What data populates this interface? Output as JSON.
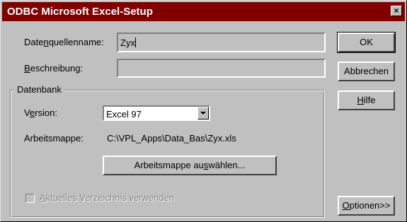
{
  "window": {
    "title": "ODBC Microsoft Excel-Setup",
    "close_label": "×"
  },
  "form": {
    "datasource_name": {
      "label_pre": "Date",
      "label_accel": "n",
      "label_post": "quellenname:",
      "value": "Zyx"
    },
    "description": {
      "label_accel": "B",
      "label_post": "eschreibung:",
      "value": ""
    }
  },
  "database": {
    "group_label": "Datenbank",
    "version": {
      "label_pre": "V",
      "label_accel": "e",
      "label_post": "rsion:",
      "selected": "Excel 97"
    },
    "workbook": {
      "label": "Arbeitsmappe:",
      "path": "C:\\VPL_Apps\\Data_Bas\\Zyx.xls"
    },
    "select_button": {
      "label_pre": "Arbeitsmappe au",
      "label_accel": "s",
      "label_post": "wählen..."
    },
    "current_dir_checkbox": {
      "label_accel": "A",
      "label_post": "ktuelles Verzeichnis verwenden",
      "checked": false,
      "enabled": false
    }
  },
  "buttons": {
    "ok": "OK",
    "cancel": "Abbrechen",
    "help_accel": "H",
    "help_post": "ilfe",
    "options_accel": "O",
    "options_post": "ptionen>>"
  }
}
